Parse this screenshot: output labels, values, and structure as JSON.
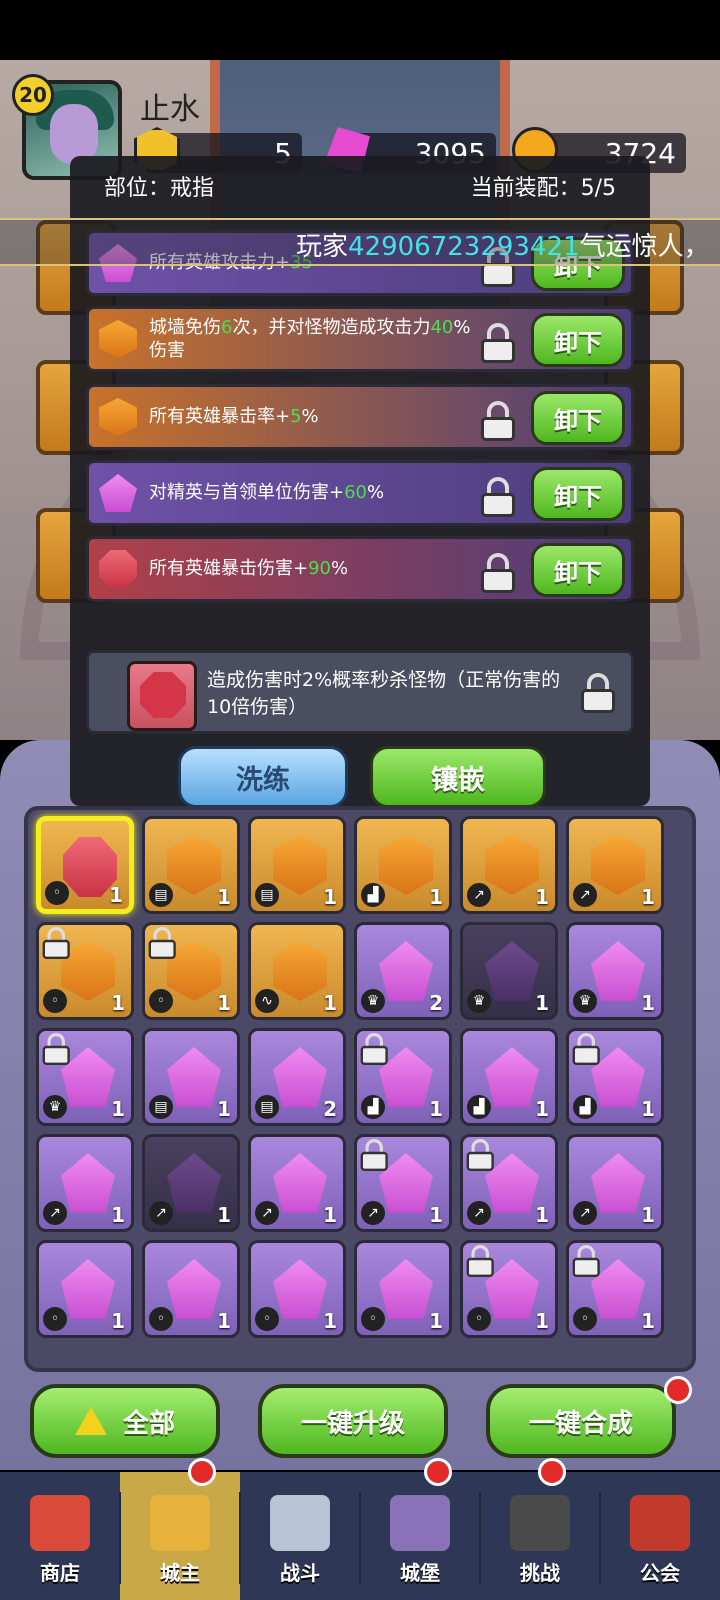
{
  "player": {
    "level": "20",
    "name": "止水"
  },
  "resources": [
    {
      "icon": "gold-gem-icon",
      "value": "5"
    },
    {
      "icon": "pink-crystal-icon",
      "value": "3095"
    },
    {
      "icon": "coin-icon",
      "value": "3724"
    }
  ],
  "popup": {
    "part_label": "部位：戒指",
    "current_label": "当前装配：5/5"
  },
  "marquee": {
    "prefix": "玩家",
    "player_id": "42906723293421",
    "suffix": "气运惊人，"
  },
  "slots": [
    {
      "parts": [
        "所有英雄攻击力+",
        "35",
        ""
      ],
      "gem": "pink-gem-icon",
      "button": "卸下"
    },
    {
      "parts": [
        "城墙免伤",
        "6",
        "次，并对怪物造成攻击力",
        "40",
        "%伤害"
      ],
      "gem": "orange-gem-icon",
      "button": "卸下"
    },
    {
      "parts": [
        "所有英雄暴击率+",
        "5",
        "%"
      ],
      "gem": "orange-gem-icon",
      "button": "卸下"
    },
    {
      "parts": [
        "对精英与首领单位伤害+",
        "60",
        "%"
      ],
      "gem": "pink-gem-icon",
      "button": "卸下"
    },
    {
      "parts": [
        "所有英雄暴击伤害+",
        "90",
        "%"
      ],
      "gem": "red-gem-icon",
      "button": "卸下"
    }
  ],
  "special": {
    "text": "造成伤害时2%概率秒杀怪物（正常伤害的10倍伤害）"
  },
  "buttons": {
    "refine": "洗练",
    "inlay": "镶嵌",
    "all": "全部",
    "upgrade_all": "一键升级",
    "merge_all": "一键合成"
  },
  "inventory": [
    {
      "color": "red",
      "shape": "oct",
      "type": "ring",
      "count": "1",
      "locked": false,
      "selected": true
    },
    {
      "color": "orange",
      "shape": "hex",
      "type": "armor",
      "count": "1",
      "locked": false
    },
    {
      "color": "orange",
      "shape": "hex",
      "type": "armor",
      "count": "1",
      "locked": false
    },
    {
      "color": "orange",
      "shape": "hex",
      "type": "boot",
      "count": "1",
      "locked": false
    },
    {
      "color": "orange",
      "shape": "hex",
      "type": "weapon",
      "count": "1",
      "locked": false
    },
    {
      "color": "orange",
      "shape": "hex",
      "type": "weapon",
      "count": "1",
      "locked": false
    },
    {
      "color": "orange",
      "shape": "hex",
      "type": "ring",
      "count": "1",
      "locked": true
    },
    {
      "color": "orange",
      "shape": "hex",
      "type": "ring",
      "count": "1",
      "locked": true
    },
    {
      "color": "orange",
      "shape": "hex",
      "type": "amulet",
      "count": "1",
      "locked": false
    },
    {
      "color": "pink",
      "shape": "pent",
      "type": "crown",
      "count": "2",
      "locked": false
    },
    {
      "color": "dark",
      "shape": "pent",
      "type": "crown",
      "count": "1",
      "locked": false
    },
    {
      "color": "pink",
      "shape": "pent",
      "type": "crown",
      "count": "1",
      "locked": false
    },
    {
      "color": "pink",
      "shape": "pent",
      "type": "crown",
      "count": "1",
      "locked": true
    },
    {
      "color": "pink",
      "shape": "pent",
      "type": "armor",
      "count": "1",
      "locked": false
    },
    {
      "color": "pink",
      "shape": "pent",
      "type": "armor",
      "count": "2",
      "locked": false
    },
    {
      "color": "pink",
      "shape": "pent",
      "type": "boot",
      "count": "1",
      "locked": true
    },
    {
      "color": "pink",
      "shape": "pent",
      "type": "boot",
      "count": "1",
      "locked": false
    },
    {
      "color": "pink",
      "shape": "pent",
      "type": "boot",
      "count": "1",
      "locked": true
    },
    {
      "color": "pink",
      "shape": "pent",
      "type": "weapon",
      "count": "1",
      "locked": false
    },
    {
      "color": "dark",
      "shape": "pent",
      "type": "weapon",
      "count": "1",
      "locked": false
    },
    {
      "color": "pink",
      "shape": "pent",
      "type": "weapon",
      "count": "1",
      "locked": false
    },
    {
      "color": "pink",
      "shape": "pent",
      "type": "weapon",
      "count": "1",
      "locked": true
    },
    {
      "color": "pink",
      "shape": "pent",
      "type": "weapon",
      "count": "1",
      "locked": true
    },
    {
      "color": "pink",
      "shape": "pent",
      "type": "weapon",
      "count": "1",
      "locked": false
    },
    {
      "color": "pink",
      "shape": "pent",
      "type": "ring",
      "count": "1",
      "locked": false
    },
    {
      "color": "pink",
      "shape": "pent",
      "type": "ring",
      "count": "1",
      "locked": false
    },
    {
      "color": "pink",
      "shape": "pent",
      "type": "ring",
      "count": "1",
      "locked": false
    },
    {
      "color": "pink",
      "shape": "pent",
      "type": "ring",
      "count": "1",
      "locked": false
    },
    {
      "color": "pink",
      "shape": "pent",
      "type": "ring",
      "count": "1",
      "locked": true
    },
    {
      "color": "pink",
      "shape": "pent",
      "type": "ring",
      "count": "1",
      "locked": true
    }
  ],
  "nav": [
    {
      "label": "商店",
      "icon": "shop-icon"
    },
    {
      "label": "城主",
      "icon": "lord-icon",
      "active": true
    },
    {
      "label": "战斗",
      "icon": "swords-icon"
    },
    {
      "label": "城堡",
      "icon": "castle-icon"
    },
    {
      "label": "挑战",
      "icon": "bomb-icon"
    },
    {
      "label": "公会",
      "icon": "guild-banner-icon"
    }
  ],
  "colors": {
    "highlight_green": "#4fdc4d",
    "id_cyan": "#40e3e7",
    "button_green": "#4fb71f",
    "selected_yellow": "#f5ee1a"
  }
}
